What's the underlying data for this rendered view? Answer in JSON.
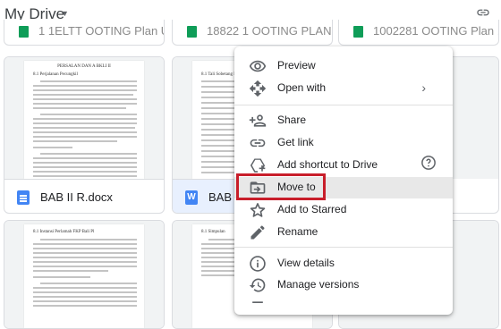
{
  "header": {
    "title": "My Drive"
  },
  "top_cards": [
    {
      "name": "1 1ELTT OOTING Plan Un..."
    },
    {
      "name": "18822 1 OOTING PLAN ..."
    },
    {
      "name": "1002281 OOTING Plan ..."
    }
  ],
  "doc_cards": [
    {
      "name": "BAB II R.docx",
      "page_header": "PERSALAN DAN A BKLI II",
      "sub_header": "8.1  Perjalanan Pecungkil"
    },
    {
      "name": "BAB II",
      "page_header": "BAB II BAHAS",
      "sub_header": "8.1  Tali Sobetang Pemantauan"
    },
    {
      "name": "",
      "page_header": "",
      "sub_header": "8.1  Instansi Perlamah FKP Bali Pl"
    },
    {
      "name": "",
      "page_header": "",
      "sub_header": "8.1  Simpulan"
    }
  ],
  "context_menu": {
    "items": [
      {
        "label": "Preview",
        "icon": "eye-icon"
      },
      {
        "label": "Open with",
        "icon": "open-with-icon",
        "submenu": true
      },
      {
        "label": "Share",
        "icon": "person-add-icon"
      },
      {
        "label": "Get link",
        "icon": "link-icon"
      },
      {
        "label": "Add shortcut to Drive",
        "icon": "add-shortcut-icon",
        "help": true
      },
      {
        "label": "Move to",
        "icon": "folder-move-icon",
        "highlighted": true
      },
      {
        "label": "Add to Starred",
        "icon": "star-icon"
      },
      {
        "label": "Rename",
        "icon": "pencil-icon"
      },
      {
        "label": "View details",
        "icon": "info-icon"
      },
      {
        "label": "Manage versions",
        "icon": "history-icon"
      }
    ]
  },
  "colors": {
    "highlight_box": "#c81e2a",
    "doc_blue": "#4285f4",
    "sheet_green": "#0f9d58",
    "icon_gray": "#5f6368"
  }
}
